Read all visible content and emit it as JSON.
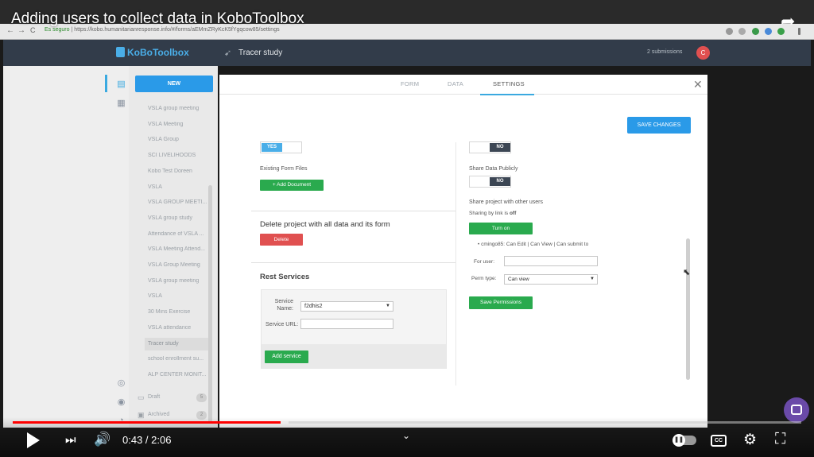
{
  "video": {
    "title": "Adding users to collect data in KoboToolbox",
    "time_current": "0:43",
    "time_total": "2:06",
    "progress": 0.34,
    "buffered": 0.35,
    "cc_label": "CC"
  },
  "browser": {
    "back": "←",
    "forward": "→",
    "reload": "C",
    "secure_label": "Es seguro",
    "url": "https://kobo.humanitarianresponse.info/#/forms/aEMmZRyKcK5fYgqcow85/settings"
  },
  "header": {
    "logo_text": "KoBoToolbox",
    "project_title": "Tracer study",
    "submissions": "2 submissions",
    "avatar_letter": "C"
  },
  "sidebar": {
    "new_label": "NEW",
    "projects": [
      "VSLA group meeting",
      "VSLA Meeting",
      "VSLA Group",
      "SCI LIVELIHOODS",
      "Kobo Test Doreen",
      "VSLA",
      "VSLA GROUP MEETI...",
      "VSLA group study",
      "Attendance of VSLA ...",
      "VSLA Meeting Attend...",
      "VSLA Group Meeting",
      "VSLA group meeting",
      "VSLA",
      "30 Mins Exercise",
      "VSLA attendance",
      "Tracer study",
      "school enrollment su...",
      "ALP CENTER MONIT..."
    ],
    "active_index": 15,
    "groups": [
      {
        "label": "Draft",
        "count": "5"
      },
      {
        "label": "Archived",
        "count": "2"
      }
    ]
  },
  "modal": {
    "tabs": [
      "FORM",
      "DATA",
      "SETTINGS"
    ],
    "active_tab": "SETTINGS",
    "save_changes": "SAVE CHANGES",
    "left": {
      "toggle_yes": "YES",
      "existing_files_label": "Existing Form Files",
      "add_document": "+ Add Document",
      "delete_heading": "Delete project with all data and its form",
      "delete_button": "Delete",
      "rest_heading": "Rest Services",
      "service_name_label": "Service Name:",
      "service_name_value": "f2dhis2",
      "service_url_label": "Service URL:",
      "add_service": "Add service"
    },
    "right": {
      "toggle1_no": "NO",
      "share_publicly_label": "Share Data Publicly",
      "toggle2_no": "NO",
      "share_users_heading": "Share project with other users",
      "sharing_link_prefix": "Sharing by link is ",
      "sharing_link_state": "off",
      "turn_on": "Turn on",
      "user_permission": "cmingo85: Can Edit | Can View | Can submit to",
      "for_user_label": "For user:",
      "perm_type_label": "Perm type:",
      "perm_type_value": "Can view",
      "save_permissions": "Save Permissions"
    }
  },
  "colors": {
    "kobo_header": "#323c4a",
    "primary": "#2a9ae8",
    "green": "#2aaa4e",
    "danger": "#e05050",
    "progress_red": "#ff0000"
  }
}
